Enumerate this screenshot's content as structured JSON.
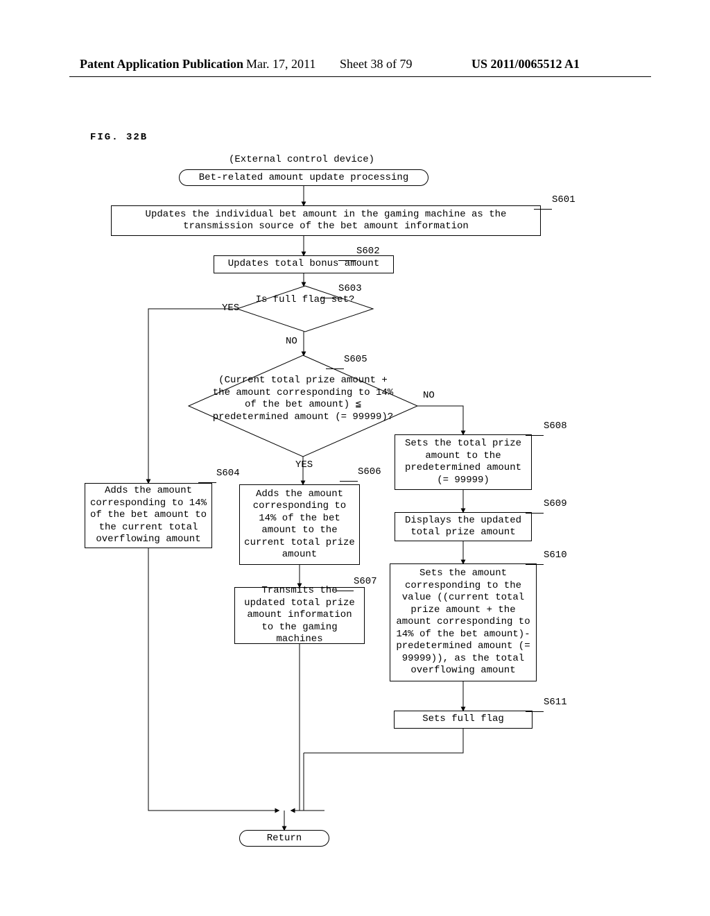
{
  "header": {
    "pub_type": "Patent Application Publication",
    "date": "Mar. 17, 2011",
    "sheet": "Sheet 38 of 79",
    "pub_no": "US 2011/0065512 A1"
  },
  "figure_label": "FIG. 32B",
  "device_label": "(External control device)",
  "steps": {
    "start": "Bet-related amount update processing",
    "S601": "Updates the individual bet amount in the gaming machine as the transmission source of the bet amount information",
    "S602": "Updates total bonus amount",
    "S603": "Is full flag set?",
    "S605": "(Current total prize amount + the amount corresponding to 14% of the bet amount) ≦ predetermined amount (= 99999)?",
    "S604": "Adds the amount corresponding to 14% of the bet amount to the current total overflowing amount",
    "S606": "Adds the amount corresponding to 14% of the bet amount to the current total prize amount",
    "S607": "Transmits the updated total prize amount information to the gaming machines",
    "S608": "Sets the total prize amount to the predetermined amount (= 99999)",
    "S609": "Displays the updated total prize amount",
    "S610": "Sets the amount corresponding to the value ((current total prize amount + the amount corresponding to 14% of the bet amount)- predetermined amount (= 99999)), as the total overflowing amount",
    "S611": "Sets full flag",
    "return": "Return"
  },
  "refs": {
    "S601": "S601",
    "S602": "S602",
    "S603": "S603",
    "S604": "S604",
    "S605": "S605",
    "S606": "S606",
    "S607": "S607",
    "S608": "S608",
    "S609": "S609",
    "S610": "S610",
    "S611": "S611"
  },
  "branches": {
    "yes": "YES",
    "no": "NO"
  }
}
